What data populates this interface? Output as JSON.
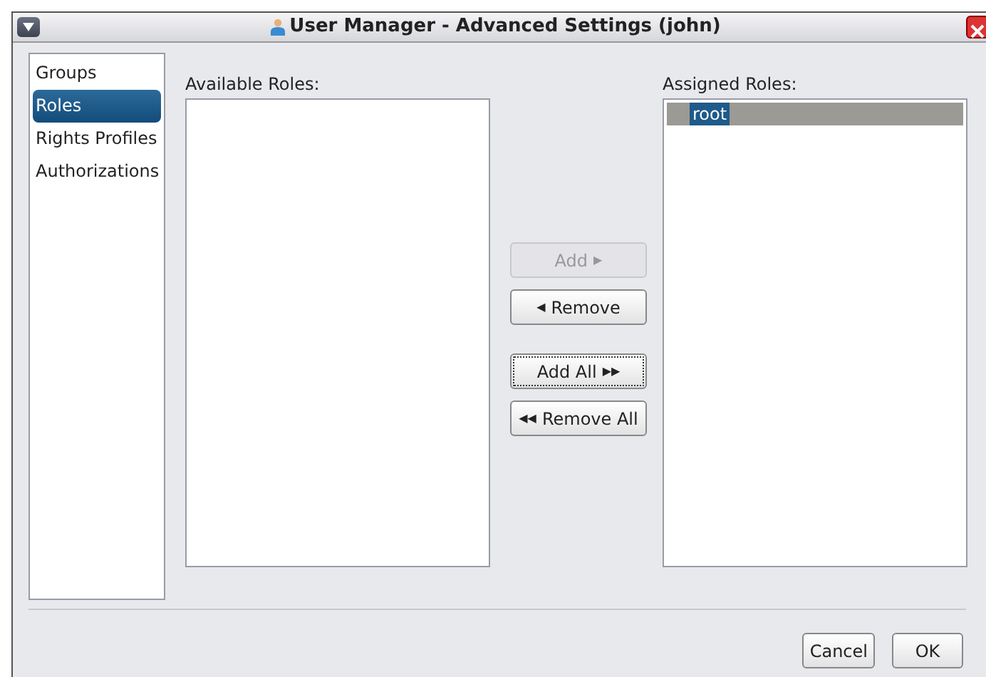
{
  "window": {
    "title": "User Manager - Advanced Settings (john)"
  },
  "sidebar": {
    "items": [
      {
        "label": "Groups",
        "selected": false
      },
      {
        "label": "Roles",
        "selected": true
      },
      {
        "label": "Rights Profiles",
        "selected": false
      },
      {
        "label": "Authorizations",
        "selected": false
      }
    ]
  },
  "available": {
    "label": "Available Roles:"
  },
  "assigned": {
    "label": "Assigned Roles:",
    "items": [
      {
        "label": "root",
        "selected": true
      }
    ]
  },
  "transfer_groups": [
    [
      {
        "label": "Add",
        "arrow_after": "▶",
        "disabled": true,
        "focused": false
      },
      {
        "label": "Remove",
        "arrow_before": "◀",
        "disabled": false,
        "focused": false
      }
    ],
    [
      {
        "label": "Add All",
        "arrow_after": "▶▶",
        "disabled": false,
        "focused": true
      },
      {
        "label": "Remove All",
        "arrow_before": "◀◀",
        "disabled": false,
        "focused": false
      }
    ]
  ],
  "buttons": [
    {
      "label": "Cancel"
    },
    {
      "label": "OK"
    }
  ]
}
